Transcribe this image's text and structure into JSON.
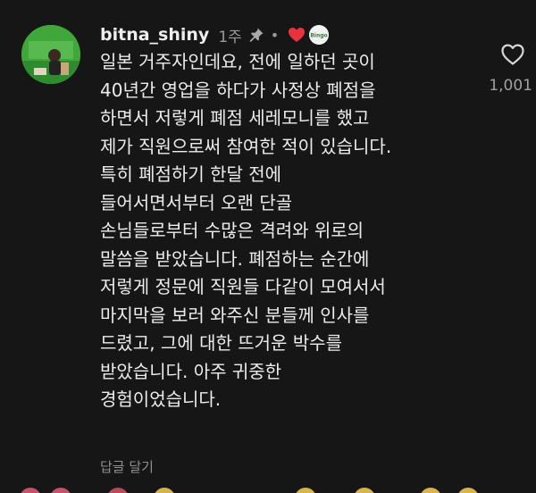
{
  "comment": {
    "username": "bitna_shiny",
    "time": "1주",
    "separator": "•",
    "creator_badge_text": "Bingo",
    "lines": [
      "일본 거주자인데요, 전에 일하던 곳이",
      "40년간 영업을 하다가 사정상 폐점을",
      "하면서 저렇게 폐점 세레모니를 했고",
      "제가 직원으로써 참여한 적이 있습니다.",
      "특히 폐점하기 한달 전에",
      "들어서면서부터 오랜 단골",
      "손님들로부터 수많은 격려와 위로의",
      "말씀을 받았습니다. 폐점하는 순간에",
      "저렇게 정문에 직원들 다같이 모여서서",
      "마지막을 보러 와주신 분들께 인사를",
      "드렸고, 그에 대한 뜨거운 박수를",
      "받았습니다. 아주 귀중한",
      "경험이었습니다."
    ],
    "like_count": "1,001",
    "reply_label": "답글 달기"
  },
  "icons": {
    "pin": "pin-icon",
    "liked_by_creator": "heart-icon",
    "like": "heart-outline-icon"
  },
  "colors": {
    "background": "#161616",
    "text": "#ececec",
    "muted": "#9a9a9a",
    "heart_red": "#e8333f",
    "avatar_green": "#3fa33a"
  }
}
